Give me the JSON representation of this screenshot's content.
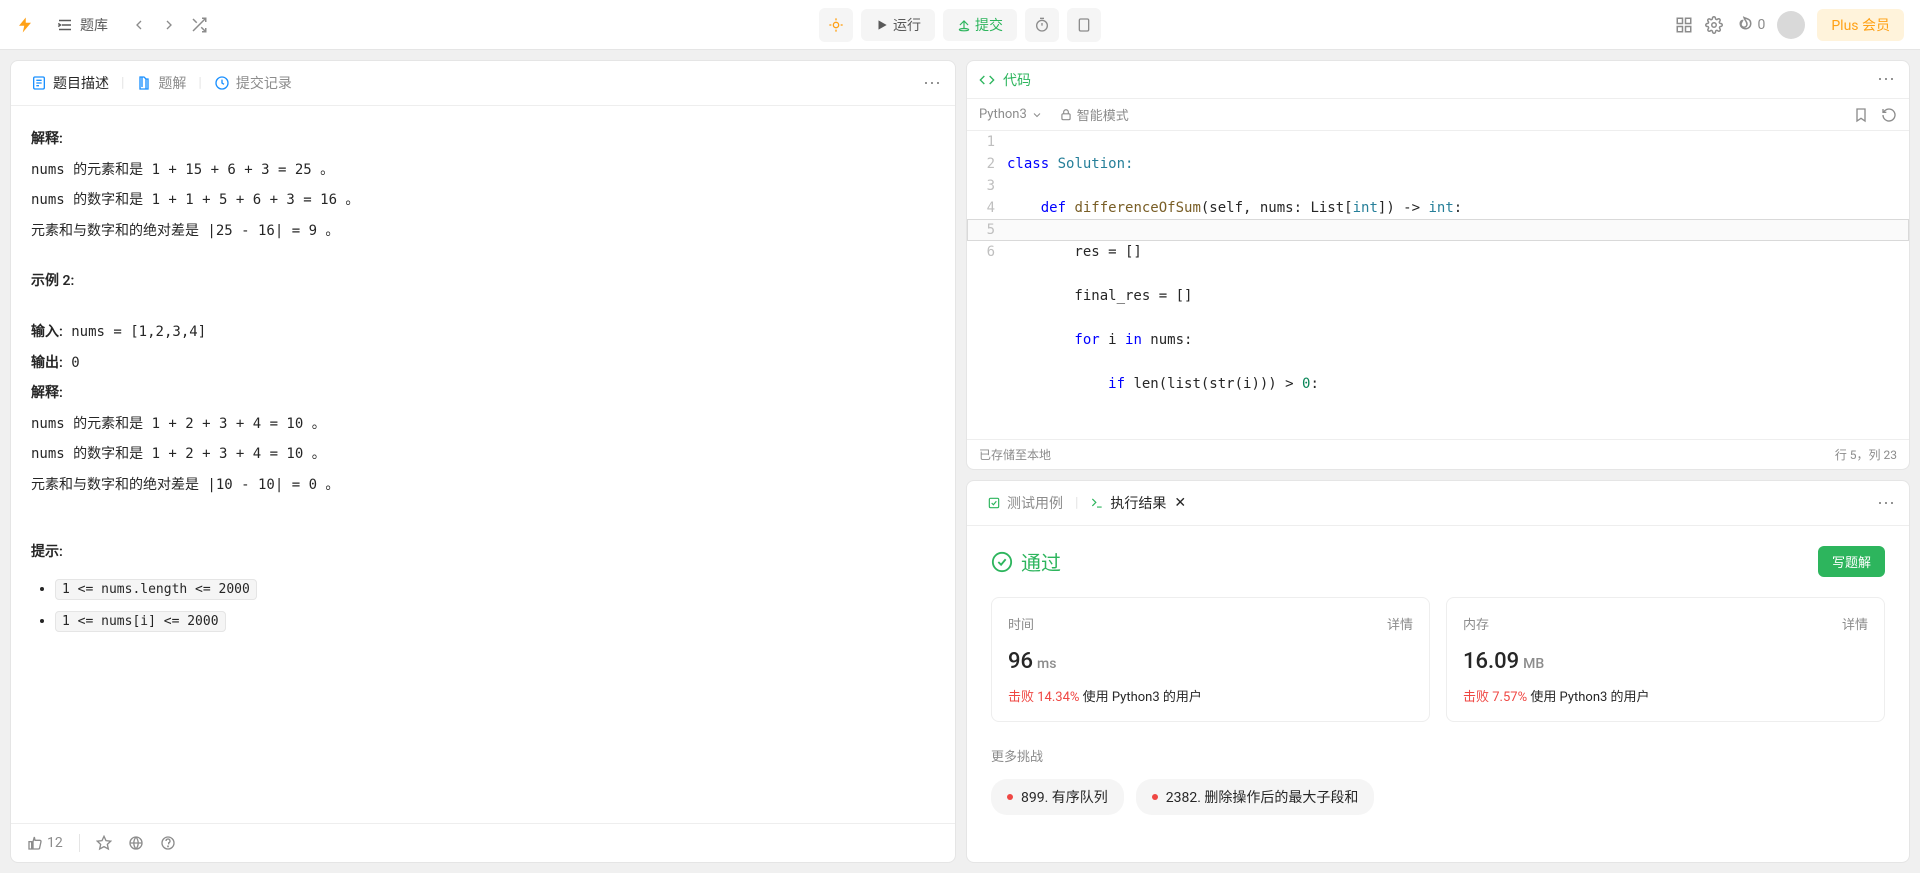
{
  "topbar": {
    "library": "题库",
    "run": "运行",
    "submit": "提交",
    "streak": "0",
    "plus": "Plus 会员"
  },
  "left_tabs": {
    "description": "题目描述",
    "solution": "题解",
    "submissions": "提交记录"
  },
  "description": {
    "l1": "解释:",
    "l2": "nums 的元素和是 1 + 15 + 6 + 3 = 25 。",
    "l3": "nums 的数字和是 1 + 1 + 5 + 6 + 3 = 16 。",
    "l4": "元素和与数字和的绝对差是 |25 - 16| = 9 。",
    "example2": "示例 2:",
    "e2_input_label": "输入:",
    "e2_input": " nums = [1,2,3,4]",
    "e2_output_label": "输出:",
    "e2_output": " 0",
    "e2_explain": "解释:",
    "e2_l1": "nums 的元素和是 1 + 2 + 3 + 4 = 10 。",
    "e2_l2": "nums 的数字和是 1 + 2 + 3 + 4 = 10 。",
    "e2_l3": "元素和与数字和的绝对差是 |10 - 10| = 0 。",
    "hints": "提示:",
    "hint1": "1 <= nums.length <= 2000",
    "hint2": "1 <= nums[i] <= 2000"
  },
  "footer": {
    "likes": "12"
  },
  "code": {
    "title": "代码",
    "language": "Python3",
    "mode": "智能模式",
    "lines": {
      "n1": "1",
      "n2": "2",
      "n3": "3",
      "n4": "4",
      "n5": "5",
      "n6": "6"
    },
    "src": {
      "l1_a": "class",
      "l1_b": " Solution:",
      "l2_a": "    def",
      "l2_b": " differenceOfSum",
      "l2_c": "(self, nums: List[",
      "l2_d": "int",
      "l2_e": "]) -> ",
      "l2_f": "int",
      "l2_g": ":",
      "l3": "        res = []",
      "l4": "        final_res = []",
      "l5_a": "        for",
      "l5_b": " i ",
      "l5_c": "in",
      "l5_d": " nums:",
      "l6_a": "            if",
      "l6_b": " len(list(str(i))) > ",
      "l6_c": "0",
      "l6_d": ":"
    },
    "status_left": "已存储至本地",
    "status_right": "行 5，列 23"
  },
  "result_tabs": {
    "testcase": "测试用例",
    "result": "执行结果"
  },
  "result": {
    "status": "通过",
    "write_solution": "写题解",
    "time_label": "时间",
    "detail": "详情",
    "time_value": "96",
    "time_unit": "ms",
    "time_beat_prefix": "击败 ",
    "time_beat_pct": "14.34%",
    "time_beat_suffix": " 使用 Python3 的用户",
    "mem_label": "内存",
    "mem_value": "16.09",
    "mem_unit": "MB",
    "mem_beat_pct": "7.57%",
    "mem_beat_suffix": " 使用 Python3 的用户",
    "more_label": "更多挑战",
    "challenge1": "899. 有序队列",
    "challenge2": "2382. 删除操作后的最大子段和"
  }
}
